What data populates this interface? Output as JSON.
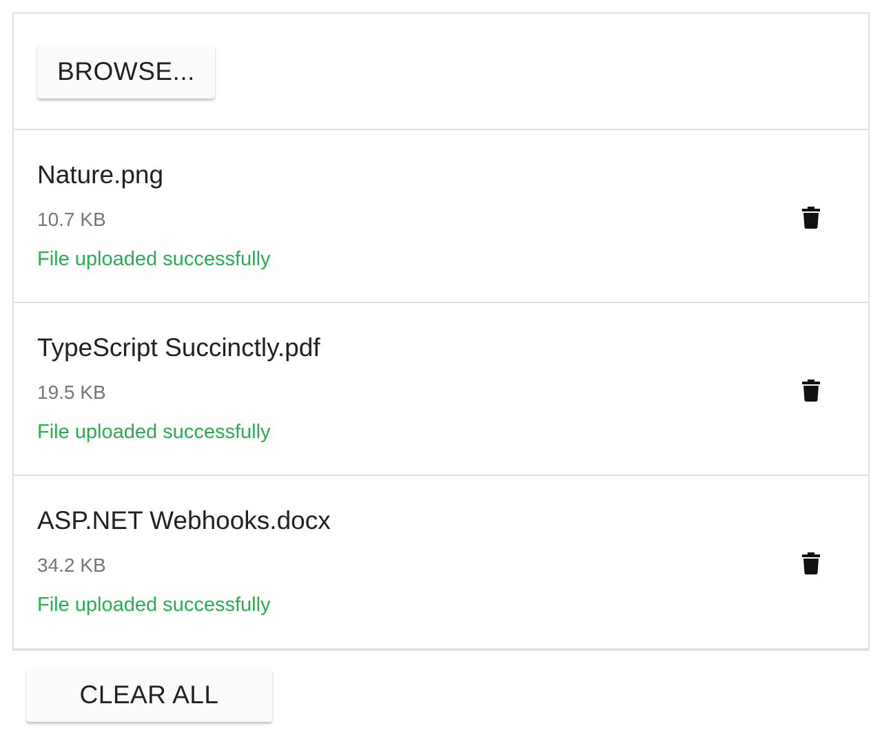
{
  "uploader": {
    "browse_label": "BROWSE...",
    "clear_label": "CLEAR ALL",
    "delete_icon": "trash-icon",
    "files": [
      {
        "name": "Nature.png",
        "size": "10.7 KB",
        "status": "File uploaded successfully"
      },
      {
        "name": "TypeScript Succinctly.pdf",
        "size": "19.5 KB",
        "status": "File uploaded successfully"
      },
      {
        "name": "ASP.NET Webhooks.docx",
        "size": "34.2 KB",
        "status": "File uploaded successfully"
      }
    ]
  },
  "colors": {
    "success": "#22b14c",
    "border": "#e0e0e0",
    "button_bg": "#fafafa"
  }
}
